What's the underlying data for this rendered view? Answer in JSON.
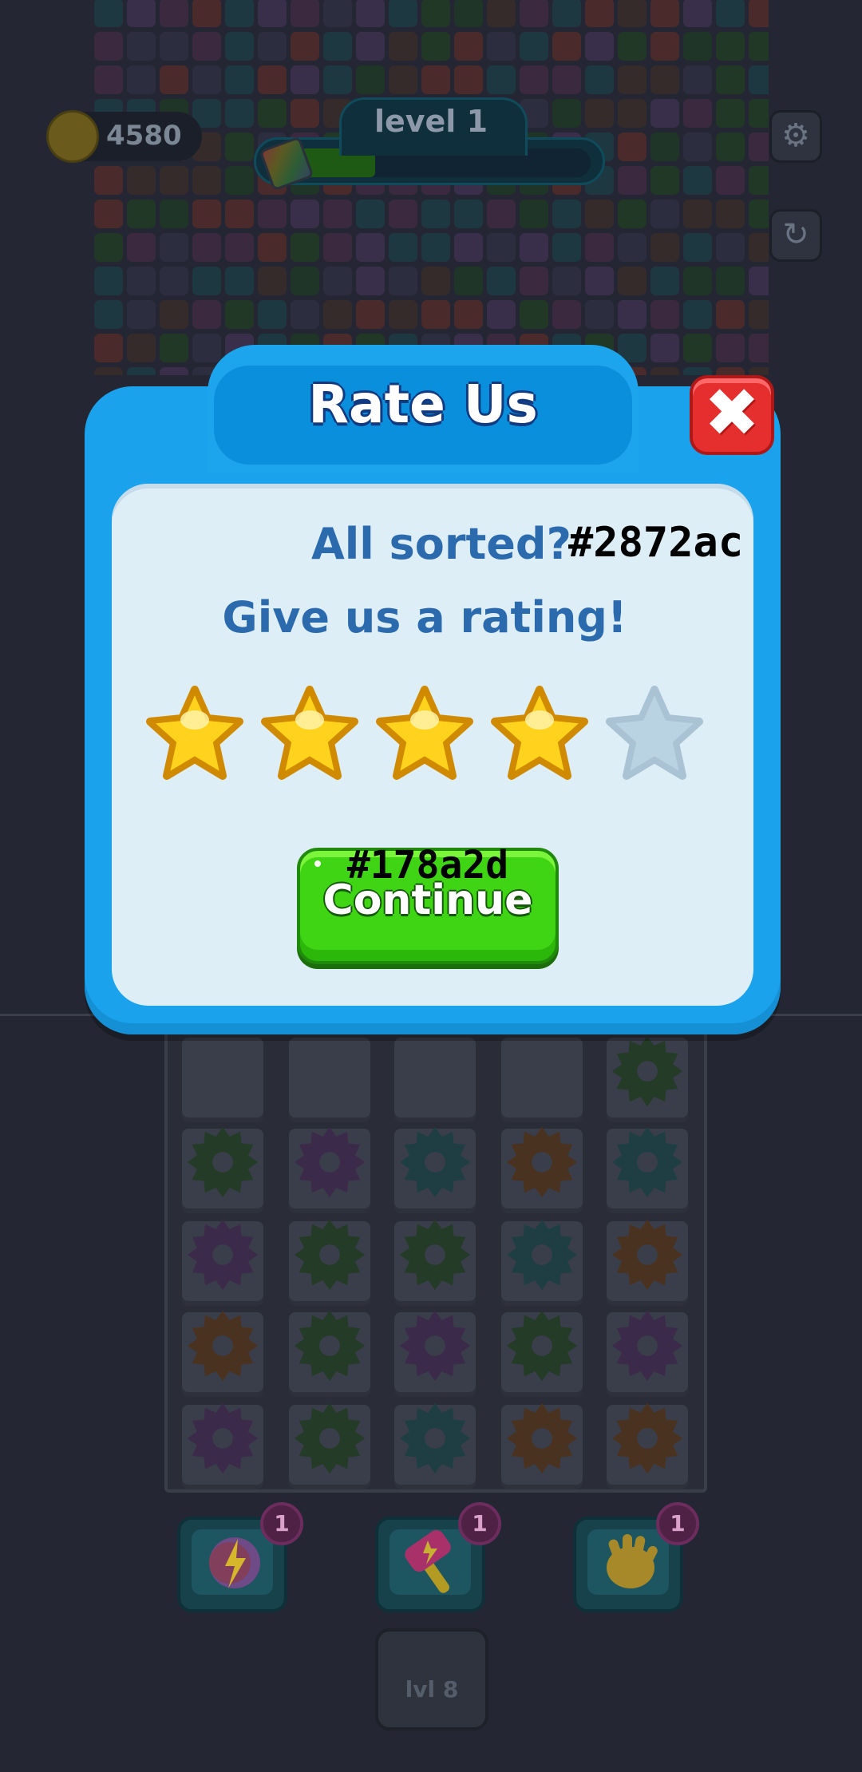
{
  "hud": {
    "coins": "4580",
    "level_label": "level 1",
    "level_progress": 0.28,
    "settings_icon": "gear-icon",
    "restart_icon": "restart-icon"
  },
  "dialog": {
    "title": "Rate Us",
    "close_icon": "close-icon",
    "line1": "All sorted?",
    "line1_code": "#2872ac",
    "line2": "Give us a rating!",
    "rating": 4,
    "max_rating": 5,
    "button_code": "#178a2d",
    "button_label": "Continue"
  },
  "boosters": [
    {
      "icon": "lightning-gear-icon",
      "count": "1"
    },
    {
      "icon": "hammer-icon",
      "count": "1"
    },
    {
      "icon": "hand-icon",
      "count": "1"
    }
  ],
  "locked_slot": {
    "label": "lvl 8"
  },
  "colors": {
    "dialog_blue": "#1aa3ec",
    "panel": "#deeef7",
    "text_blue": "#2b6aad",
    "continue_green": "#3fd414",
    "close_red": "#e52e2e",
    "star_gold": "#ffd21e"
  }
}
